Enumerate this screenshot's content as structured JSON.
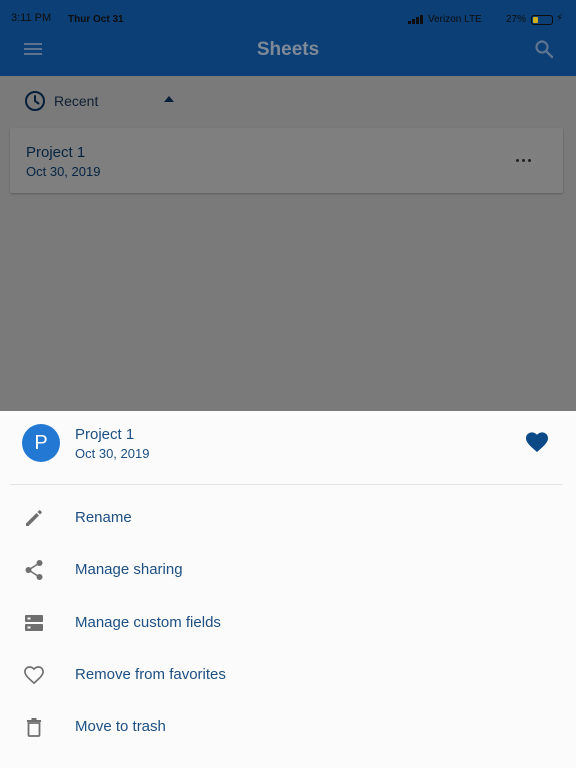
{
  "status_bar": {
    "time": "3:11 PM",
    "date": "Thur Oct 31",
    "carrier": "Verizon  LTE",
    "battery_percent": "27%",
    "battery_level": 0.27
  },
  "app_bar": {
    "title": "Sheets",
    "menu_icon": "hamburger-menu-icon",
    "search_icon": "search-icon",
    "background_color": "#0b3f75"
  },
  "filter": {
    "label": "Recent",
    "icon": "clock-icon"
  },
  "sheets": [
    {
      "name": "Project 1",
      "date": "Oct 30, 2019"
    }
  ],
  "bottom_sheet": {
    "avatar_letter": "P",
    "avatar_color": "#2278d3",
    "name": "Project 1",
    "date": "Oct 30, 2019",
    "favorite_icon": "heart-filled-icon",
    "actions": [
      {
        "label": "Rename",
        "icon": "pencil-icon"
      },
      {
        "label": "Manage sharing",
        "icon": "share-icon"
      },
      {
        "label": "Manage custom fields",
        "icon": "custom-fields-icon"
      },
      {
        "label": "Remove from favorites",
        "icon": "heart-outline-icon"
      },
      {
        "label": "Move to trash",
        "icon": "trash-icon"
      }
    ]
  },
  "colors": {
    "accent": "#0b4a86",
    "text_link": "#1d4f83",
    "icon_gray": "#6f6f6f"
  }
}
